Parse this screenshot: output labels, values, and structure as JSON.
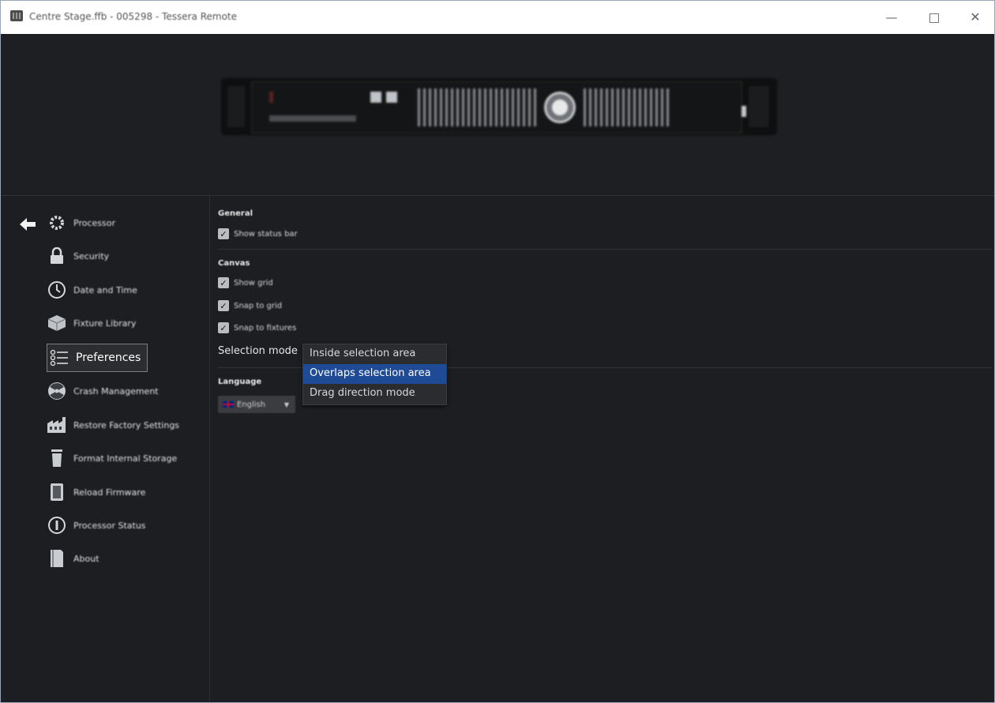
{
  "window": {
    "title": "Centre Stage.ffb - 005298 - Tessera Remote",
    "controls": {
      "minimize": "—",
      "maximize": "☐",
      "close": "✕"
    }
  },
  "sidebar": {
    "back_icon": "arrow-left-icon",
    "items": [
      {
        "label": "Processor",
        "icon": "gear-icon"
      },
      {
        "label": "Security",
        "icon": "lock-icon"
      },
      {
        "label": "Date and Time",
        "icon": "clock-icon"
      },
      {
        "label": "Fixture Library",
        "icon": "box-icon"
      },
      {
        "label": "Preferences",
        "icon": "list-icon",
        "active": true
      },
      {
        "label": "Crash Management",
        "icon": "radiation-icon"
      },
      {
        "label": "Restore Factory Settings",
        "icon": "factory-icon"
      },
      {
        "label": "Format Internal Storage",
        "icon": "trash-icon"
      },
      {
        "label": "Reload Firmware",
        "icon": "chip-icon"
      },
      {
        "label": "Processor Status",
        "icon": "info-icon"
      },
      {
        "label": "About",
        "icon": "book-icon"
      }
    ]
  },
  "preferences": {
    "general": {
      "heading": "General",
      "show_status_bar": {
        "label": "Show status bar",
        "checked": true
      }
    },
    "canvas": {
      "heading": "Canvas",
      "show_grid": {
        "label": "Show grid",
        "checked": true
      },
      "snap_to_grid": {
        "label": "Snap to grid",
        "checked": true
      },
      "snap_to_fixtures": {
        "label": "Snap to fixtures",
        "checked": true
      },
      "selection_mode": {
        "label": "Selection mode",
        "options": [
          "Inside selection area",
          "Overlaps selection area",
          "Drag direction mode"
        ],
        "highlighted": "Overlaps selection area"
      }
    },
    "language": {
      "heading": "Language",
      "value": "English"
    }
  },
  "colors": {
    "background": "#1c1e21",
    "highlight": "#1f4a96",
    "text": "#e1e3e6"
  }
}
